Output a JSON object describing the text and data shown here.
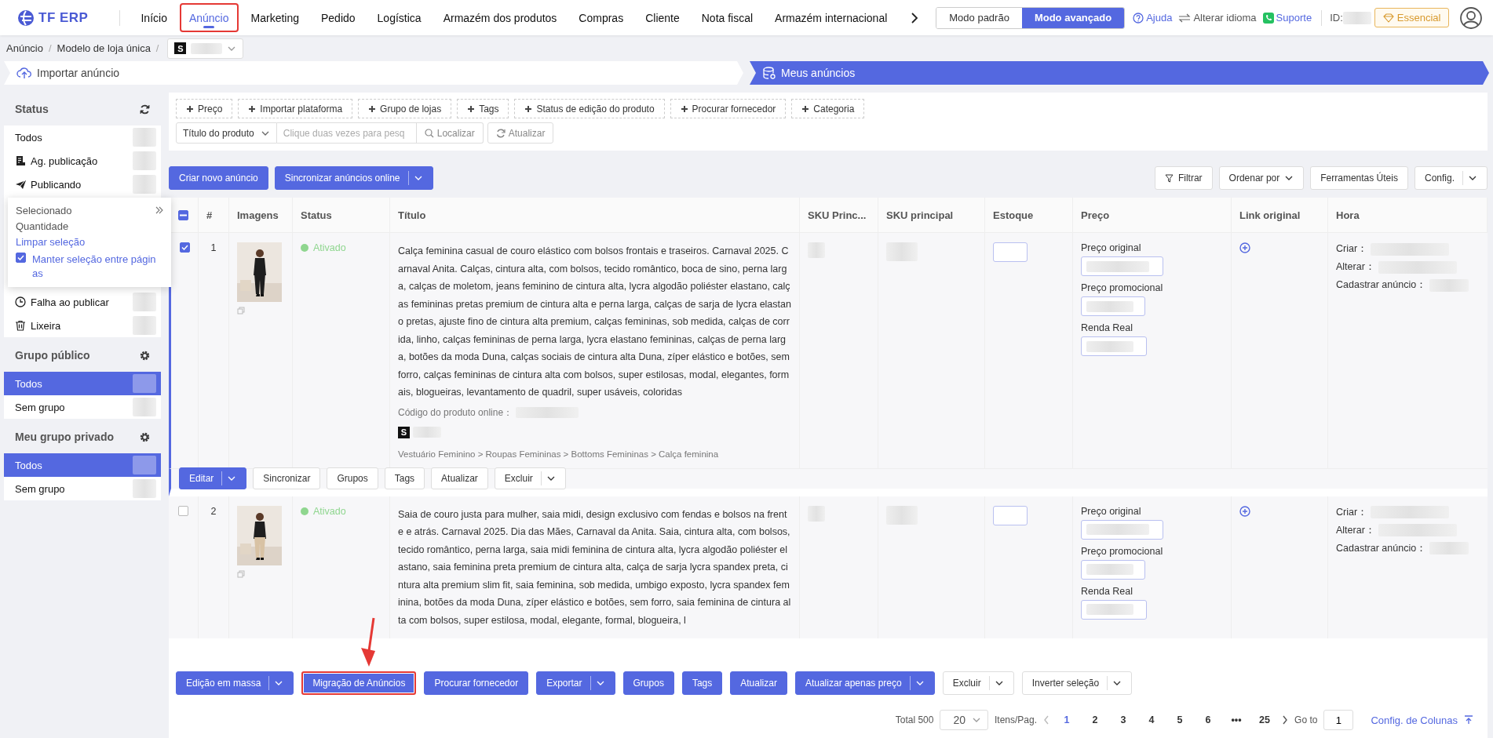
{
  "header": {
    "logo": "TF ERP",
    "nav": [
      {
        "label": "Início",
        "selected": false,
        "highlighted": false
      },
      {
        "label": "Anúncio",
        "selected": true,
        "highlighted": true
      },
      {
        "label": "Marketing",
        "selected": false,
        "highlighted": false
      },
      {
        "label": "Pedido",
        "selected": false,
        "highlighted": false
      },
      {
        "label": "Logística",
        "selected": false,
        "highlighted": false
      },
      {
        "label": "Armazém dos produtos",
        "selected": false,
        "highlighted": false
      },
      {
        "label": "Compras",
        "selected": false,
        "highlighted": false
      },
      {
        "label": "Cliente",
        "selected": false,
        "highlighted": false
      },
      {
        "label": "Nota fiscal",
        "selected": false,
        "highlighted": false
      },
      {
        "label": "Armazém internacional",
        "selected": false,
        "highlighted": false
      }
    ],
    "modes": [
      {
        "label": "Modo padrão",
        "selected": false
      },
      {
        "label": "Modo avançado",
        "selected": true
      }
    ],
    "links": [
      {
        "kind": "help",
        "label": "Ajuda"
      },
      {
        "kind": "language",
        "label": "Alterar idioma"
      },
      {
        "kind": "support",
        "label": "Suporte"
      }
    ],
    "id_label": "ID:",
    "plan": "Essencial"
  },
  "breadcrumb": {
    "items": [
      "Anúncio",
      "Modelo de loja única"
    ],
    "separator": "/",
    "store_badge": "S"
  },
  "steps": [
    {
      "label": "Importar anúncio",
      "selected": false
    },
    {
      "label": "Meus anúncios",
      "selected": true
    }
  ],
  "sidebar": {
    "sections": [
      {
        "title": "Status",
        "kind": "refresh",
        "items": [
          {
            "label": "Todos",
            "kind": "plain",
            "selected": false
          },
          {
            "label": "Ag. publicação",
            "kind": "document",
            "selected": false
          },
          {
            "label": "Publicando",
            "kind": "plane",
            "selected": false
          },
          {
            "kind": "covered"
          },
          {
            "label": "Falha ao publicar",
            "kind": "clock",
            "selected": false
          },
          {
            "label": "Lixeira",
            "kind": "trash",
            "selected": false
          }
        ]
      },
      {
        "title": "Grupo público",
        "kind": "settings",
        "items": [
          {
            "label": "Todos",
            "kind": "plain",
            "selected": true
          },
          {
            "label": "Sem grupo",
            "kind": "plain",
            "selected": false
          }
        ]
      },
      {
        "title": "Meu grupo privado",
        "kind": "settings",
        "items": [
          {
            "label": "Todos",
            "kind": "plain",
            "selected": true
          },
          {
            "label": "Sem grupo",
            "kind": "plain",
            "selected": false
          }
        ]
      }
    ]
  },
  "selection_popover": {
    "title": "Selecionado",
    "count_label": "Quantidade",
    "clear": "Limpar seleção",
    "keep_selection": {
      "label": "Manter seleção entre páginas",
      "checked": true
    }
  },
  "filters": {
    "chips": [
      "Preço",
      "Importar plataforma",
      "Grupo de lojas",
      "Tags",
      "Status de edição do produto",
      "Procurar fornecedor",
      "Categoria"
    ],
    "search_field": "Título do produto",
    "search": {
      "placeholder": "Clique duas vezes para pesq"
    },
    "find": "Localizar",
    "refresh": "Atualizar"
  },
  "actions": {
    "left": [
      {
        "label": "Criar novo anúncio",
        "split": false
      },
      {
        "label": "Sincronizar anúncios online",
        "split": true
      }
    ],
    "right": [
      {
        "label": "Filtrar",
        "kind": "filter"
      },
      {
        "label": "Ordenar por",
        "kind": "dropdown"
      },
      {
        "label": "Ferramentas Úteis",
        "kind": "plain"
      },
      {
        "label": "Config.",
        "kind": "split"
      }
    ]
  },
  "table": {
    "select_all": {
      "checked": true,
      "indeterminate": true
    },
    "columns": [
      "#",
      "Imagens",
      "Status",
      "Título",
      "SKU Princ...",
      "SKU principal",
      "Estoque",
      "Preço",
      "Link original",
      "Hora"
    ],
    "rows": [
      {
        "selected": true,
        "index": "1",
        "image": {
          "kind": "picture"
        },
        "status": {
          "label": "Ativado",
          "kind": "active"
        },
        "title": "Calça feminina casual de couro elástico com bolsos frontais e traseiros. Carnaval 2025. Carnaval Anita. Calças, cintura alta, com bolsos, tecido romântico, boca de sino, perna larga, calças de moletom, jeans feminino de cintura alta, lycra algodão poliéster elastano, calças femininas pretas premium de cintura alta e perna larga, calças de sarja de lycra elastano pretas, ajuste fino de cintura alta premium, calças femininas, sob medida, calças de corrida, linho, calças femininas de perna larga, lycra elastano femininas, calças de perna larga, botões da moda Duna, calças sociais de cintura alta Duna, zíper elástico e botões, sem forro, calças femininas de cintura alta com bolsos, super estilosas, modal, elegantes, formais, blogueiras, levantamento de quadril, super usáveis, coloridas",
        "code_label": "Código do produto online：",
        "store_badge": "S",
        "category": "Vestuário Feminino > Roupas Femininas > Bottoms Femininas > Calça feminina",
        "prices": [
          "Preço original",
          "Preço promocional",
          "Renda Real"
        ],
        "times": [
          "Criar：",
          "Alterar：",
          "Cadastrar anúncio："
        ],
        "actions": [
          {
            "label": "Editar",
            "kind": "primary-split"
          },
          {
            "label": "Sincronizar",
            "kind": "plain"
          },
          {
            "label": "Grupos",
            "kind": "plain"
          },
          {
            "label": "Tags",
            "kind": "plain"
          },
          {
            "label": "Atualizar",
            "kind": "plain"
          },
          {
            "label": "Excluir",
            "kind": "split"
          }
        ]
      },
      {
        "selected": false,
        "index": "2",
        "image": {
          "kind": "picture"
        },
        "status": {
          "label": "Ativado",
          "kind": "active"
        },
        "title": "Saia de couro justa para mulher, saia midi, design exclusivo com fendas e bolsos na frente e atrás. Carnaval 2025. Dia das Mães, Carnaval da Anita. Saia, cintura alta, com bolsos, tecido romântico, perna larga, saia midi feminina de cintura alta, lycra algodão poliéster elastano, saia feminina preta premium de cintura alta, calça de sarja lycra spandex preta, cintura alta premium slim fit, saia feminina, sob medida, umbigo exposto, lycra spandex feminina, botões da moda Duna, zíper elástico e botões, sem forro, saia feminina de cintura alta com bolsos, super estilosa, modal, elegante, formal, blogueira, l",
        "prices": [
          "Preço original",
          "Preço promocional",
          "Renda Real"
        ],
        "times": [
          "Criar：",
          "Alterar：",
          "Cadastrar anúncio："
        ]
      }
    ]
  },
  "bulk_actions": [
    {
      "label": "Edição em massa",
      "kind": "primary-split",
      "highlighted": false
    },
    {
      "label": "Migração de Anúncios",
      "kind": "primary",
      "highlighted": true
    },
    {
      "label": "Procurar fornecedor",
      "kind": "primary",
      "highlighted": false
    },
    {
      "label": "Exportar",
      "kind": "primary-split",
      "highlighted": false
    },
    {
      "label": "Grupos",
      "kind": "primary",
      "highlighted": false
    },
    {
      "label": "Tags",
      "kind": "primary",
      "highlighted": false
    },
    {
      "label": "Atualizar",
      "kind": "primary",
      "highlighted": false
    },
    {
      "label": "Atualizar apenas preço",
      "kind": "primary-split",
      "highlighted": false
    },
    {
      "label": "Excluir",
      "kind": "split",
      "highlighted": false
    },
    {
      "label": "Inverter seleção",
      "kind": "split",
      "highlighted": false
    }
  ],
  "pagination": {
    "total": "Total 500",
    "page_size": "20",
    "per_page_label": "Itens/Pag.",
    "pages": [
      {
        "label": "1",
        "selected": true
      },
      {
        "label": "2",
        "selected": false
      },
      {
        "label": "3",
        "selected": false
      },
      {
        "label": "4",
        "selected": false
      },
      {
        "label": "5",
        "selected": false
      },
      {
        "label": "6",
        "selected": false
      },
      {
        "label": "•••",
        "selected": false
      },
      {
        "label": "25",
        "selected": false
      }
    ],
    "goto_label": "Go to",
    "goto_value": "1",
    "columns_link": "Config. de Colunas"
  },
  "annotations": [
    {
      "kind": "arrow"
    }
  ]
}
